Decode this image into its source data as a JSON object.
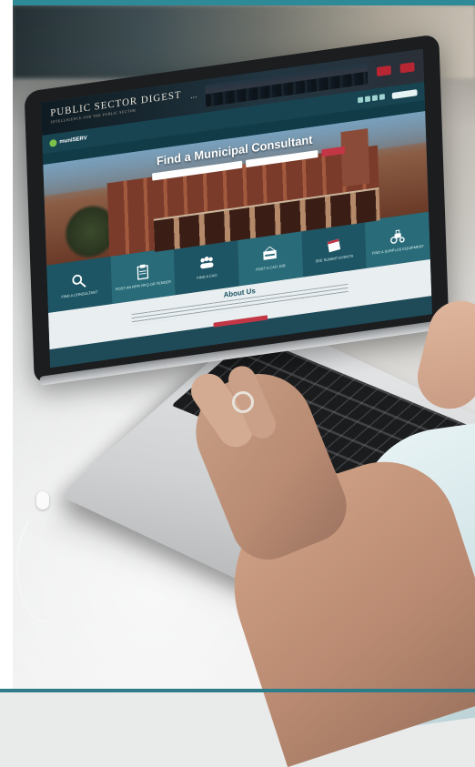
{
  "screen": {
    "header": {
      "logo_title": "PUBLIC SECTOR DIGEST",
      "logo_subtitle": "INTELLIGENCE FOR THE PUBLIC SECTOR"
    },
    "nav": {
      "brand": "muniSERV"
    },
    "hero": {
      "title": "Find a Municipal Consultant"
    },
    "tiles": [
      {
        "icon": "magnifier-icon",
        "label": "FIND A CONSULTANT"
      },
      {
        "icon": "clipboard-icon",
        "label": "POST AN RFP/ RFQ OR TENDER"
      },
      {
        "icon": "people-icon",
        "label": "FIND A CAO"
      },
      {
        "icon": "now-hiring-sign-icon",
        "label": "POST A CAO JOB"
      },
      {
        "icon": "calendar-icon",
        "label": "SEE SUMMIT EVENTS"
      },
      {
        "icon": "tractor-icon",
        "label": "FIND A SURPLUS EQUIPMENT"
      }
    ],
    "about": {
      "title": "About Us"
    }
  },
  "colors": {
    "frame_teal": "#2e8a97",
    "site_teal_dark": "#1e5564",
    "site_teal_light": "#2a6b79",
    "accent_red": "#c23645",
    "brand_green": "#7cc24a"
  }
}
